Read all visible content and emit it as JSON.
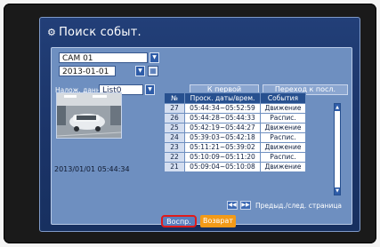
{
  "window": {
    "title": "Поиск событ."
  },
  "filters": {
    "camera_value": "CAM 01",
    "date_value": "2013-01-01",
    "overlap_label": "Налож. данных",
    "overlap_value": "List0"
  },
  "nav": {
    "first_label": "К первой",
    "last_label": "Переход к посл."
  },
  "preview": {
    "timestamp": "2013/01/01 05:44:34"
  },
  "table": {
    "headers": [
      "№",
      "Проск. даты/врем.",
      "События"
    ],
    "rows": [
      {
        "num": "27",
        "time": "05:44:34~05:52:59",
        "type": "Движение"
      },
      {
        "num": "26",
        "time": "05:44:28~05:44:33",
        "type": "Распис."
      },
      {
        "num": "25",
        "time": "05:42:19~05:44:27",
        "type": "Движение"
      },
      {
        "num": "24",
        "time": "05:39:03~05:42:18",
        "type": "Распис."
      },
      {
        "num": "23",
        "time": "05:11:21~05:39:02",
        "type": "Движение"
      },
      {
        "num": "22",
        "time": "05:10:09~05:11:20",
        "type": "Распис."
      },
      {
        "num": "21",
        "time": "05:09:04~05:10:08",
        "type": "Движение"
      }
    ]
  },
  "paging": {
    "label": "Предыд./след. страница"
  },
  "buttons": {
    "play_label": "Воспр.",
    "back_label": "Возврат"
  },
  "colors": {
    "accent_red": "#e01b1b",
    "back_orange": "#f39a18",
    "panel_blue": "#6e8fc0"
  }
}
